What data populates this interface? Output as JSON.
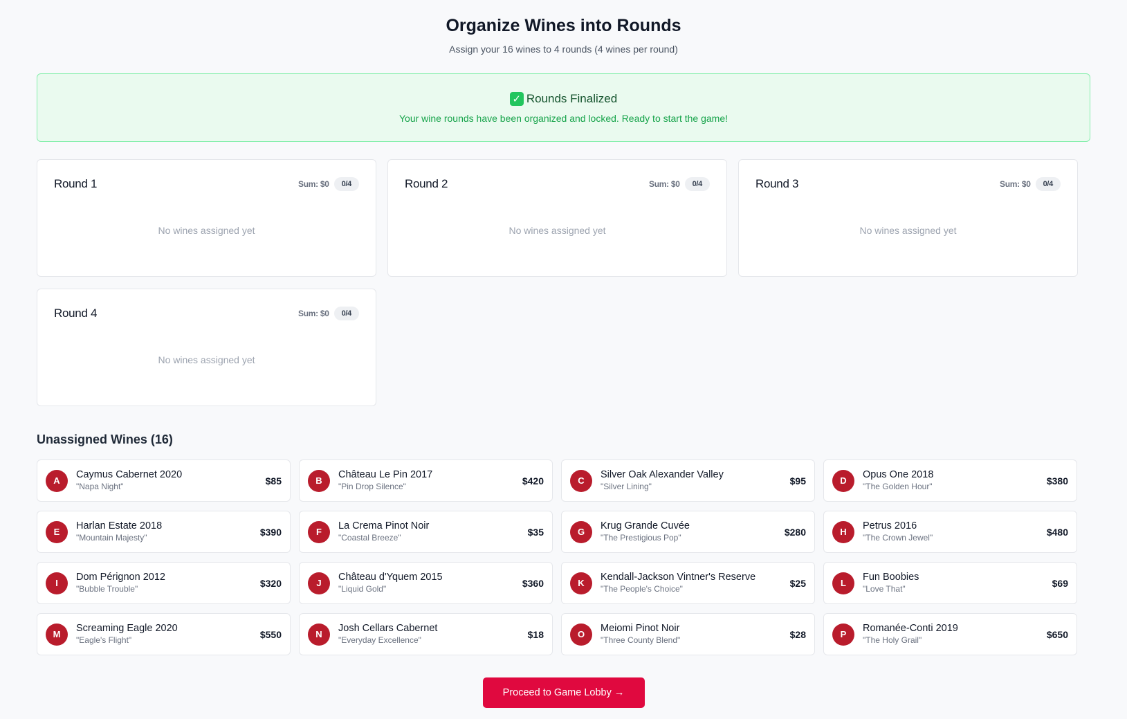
{
  "header": {
    "title": "Organize Wines into Rounds",
    "subtitle": "Assign your 16 wines to 4 rounds (4 wines per round)"
  },
  "banner": {
    "icon": "check-mark-icon",
    "title": "Rounds Finalized",
    "message": "Your wine rounds have been organized and locked. Ready to start the game!",
    "colors": {
      "background": "#eafaef",
      "border": "#86efac",
      "text": "#16a34a"
    }
  },
  "rounds": [
    {
      "name": "Round 1",
      "sum": "Sum: $0",
      "count": "0/4",
      "empty": "No wines assigned yet"
    },
    {
      "name": "Round 2",
      "sum": "Sum: $0",
      "count": "0/4",
      "empty": "No wines assigned yet"
    },
    {
      "name": "Round 3",
      "sum": "Sum: $0",
      "count": "0/4",
      "empty": "No wines assigned yet"
    },
    {
      "name": "Round 4",
      "sum": "Sum: $0",
      "count": "0/4",
      "empty": "No wines assigned yet"
    }
  ],
  "unassigned": {
    "title": "Unassigned Wines (16)",
    "wines": [
      {
        "letter": "A",
        "name": "Caymus Cabernet 2020",
        "nickname": "\"Napa Night\"",
        "price": "$85"
      },
      {
        "letter": "B",
        "name": "Château Le Pin 2017",
        "nickname": "\"Pin Drop Silence\"",
        "price": "$420"
      },
      {
        "letter": "C",
        "name": "Silver Oak Alexander Valley",
        "nickname": "\"Silver Lining\"",
        "price": "$95"
      },
      {
        "letter": "D",
        "name": "Opus One 2018",
        "nickname": "\"The Golden Hour\"",
        "price": "$380"
      },
      {
        "letter": "E",
        "name": "Harlan Estate 2018",
        "nickname": "\"Mountain Majesty\"",
        "price": "$390"
      },
      {
        "letter": "F",
        "name": "La Crema Pinot Noir",
        "nickname": "\"Coastal Breeze\"",
        "price": "$35"
      },
      {
        "letter": "G",
        "name": "Krug Grande Cuvée",
        "nickname": "\"The Prestigious Pop\"",
        "price": "$280"
      },
      {
        "letter": "H",
        "name": "Petrus 2016",
        "nickname": "\"The Crown Jewel\"",
        "price": "$480"
      },
      {
        "letter": "I",
        "name": "Dom Pérignon 2012",
        "nickname": "\"Bubble Trouble\"",
        "price": "$320"
      },
      {
        "letter": "J",
        "name": "Château d'Yquem 2015",
        "nickname": "\"Liquid Gold\"",
        "price": "$360"
      },
      {
        "letter": "K",
        "name": "Kendall-Jackson Vintner's Reserve",
        "nickname": "\"The People's Choice\"",
        "price": "$25"
      },
      {
        "letter": "L",
        "name": "Fun Boobies",
        "nickname": "\"Love That\"",
        "price": "$69"
      },
      {
        "letter": "M",
        "name": "Screaming Eagle 2020",
        "nickname": "\"Eagle's Flight\"",
        "price": "$550"
      },
      {
        "letter": "N",
        "name": "Josh Cellars Cabernet",
        "nickname": "\"Everyday Excellence\"",
        "price": "$18"
      },
      {
        "letter": "O",
        "name": "Meiomi Pinot Noir",
        "nickname": "\"Three County Blend\"",
        "price": "$28"
      },
      {
        "letter": "P",
        "name": "Romanée-Conti 2019",
        "nickname": "\"The Holy Grail\"",
        "price": "$650"
      }
    ]
  },
  "footer": {
    "proceed_label": "Proceed to Game Lobby",
    "proceed_icon": "arrow-right-icon",
    "accent_color": "#e0093f"
  },
  "badge_color": "#b91c2c"
}
